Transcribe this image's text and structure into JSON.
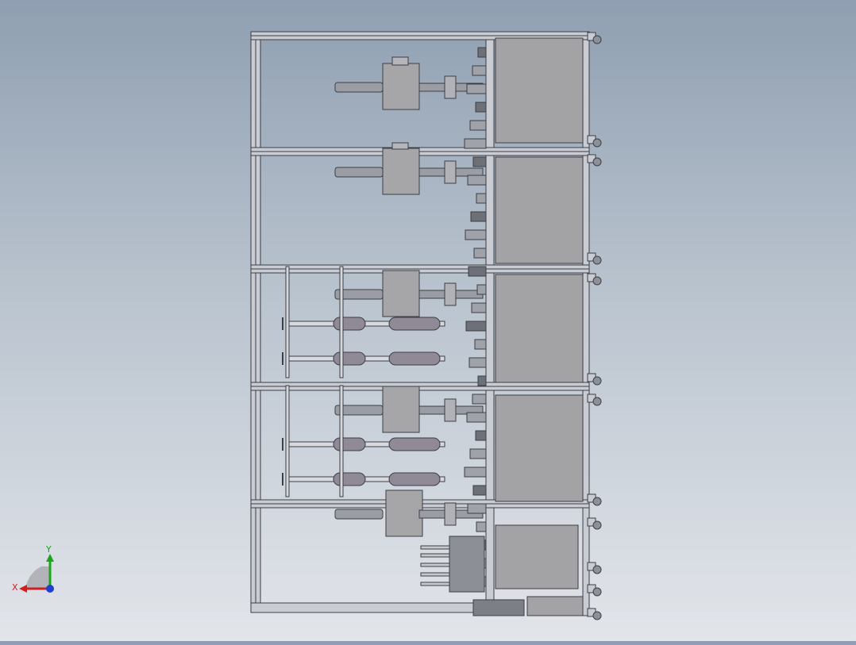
{
  "viewport": {
    "background_top": "#8f9fb1",
    "background_bottom": "#e2e5ea"
  },
  "model": {
    "frame_color": "#c9ccd2",
    "frame_edge": "#3c3f45",
    "panel_color": "#a3a3a6",
    "cylinder_color": "#9a9da3",
    "motor_color": "#a6a6a8",
    "belt_color": "#8f8a96",
    "bay_count": 5,
    "caster_count": 12
  },
  "triad": {
    "x_label": "X",
    "y_label": "Y",
    "x_color": "#d11f1f",
    "y_color": "#1aa51a",
    "z_color": "#1f3fcf"
  }
}
